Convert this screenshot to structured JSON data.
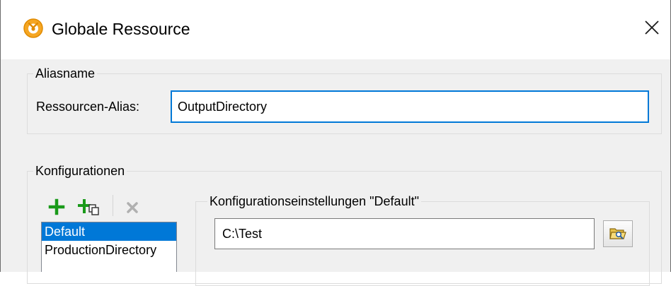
{
  "window": {
    "title": "Globale Ressource"
  },
  "alias_group": {
    "legend": "Aliasname",
    "alias_label": "Ressourcen-Alias:",
    "alias_value": "OutputDirectory"
  },
  "config_group": {
    "legend": "Konfigurationen",
    "toolbar": {
      "add_icon": "plus-icon",
      "copy_icon": "add-copy-icon",
      "delete_icon": "delete-x-icon"
    },
    "items": [
      {
        "label": "Default",
        "selected": true
      },
      {
        "label": "ProductionDirectory",
        "selected": false
      }
    ],
    "settings": {
      "legend": "Konfigurationseinstellungen \"Default\"",
      "path_value": "C:\\Test",
      "browse_icon": "open-folder-icon"
    }
  },
  "colors": {
    "selection": "#0078d7",
    "focus_border": "#0078d7",
    "add_green": "#1a9a1a",
    "app_icon_orange": "#f5a623"
  }
}
